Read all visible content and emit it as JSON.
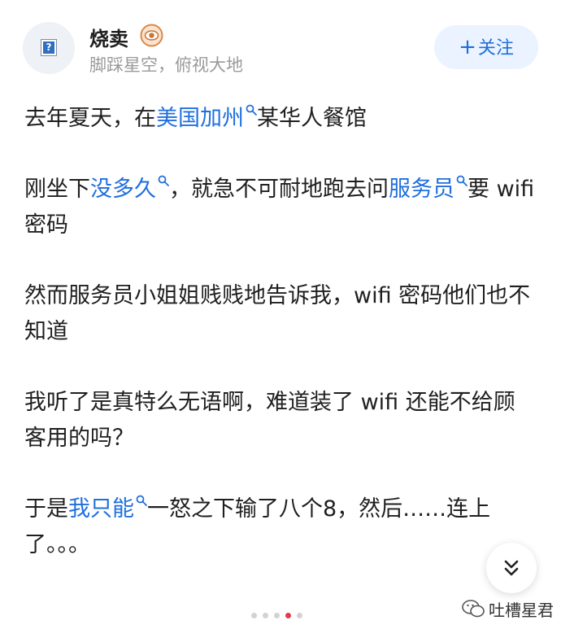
{
  "header": {
    "author_name": "烧卖",
    "author_bio": "脚踩星空，俯视大地",
    "follow_label": "关注"
  },
  "post": {
    "paragraphs": [
      [
        {
          "t": "去年夏天，在"
        },
        {
          "t": "美国加州",
          "link": true
        },
        {
          "t": "某华人餐馆"
        }
      ],
      [
        {
          "t": "刚坐下"
        },
        {
          "t": "没多久",
          "link": true
        },
        {
          "t": "，就急不可耐地跑去问"
        },
        {
          "t": "服务员",
          "link": true
        },
        {
          "t": "要 wifi 密码"
        }
      ],
      [
        {
          "t": "然而服务员小姐姐贱贱地告诉我，wifi 密码他们也不知道"
        }
      ],
      [
        {
          "t": "我听了是真特么无语啊，难道装了 wifi 还能不给顾客用的吗？"
        }
      ],
      [
        {
          "t": "于是"
        },
        {
          "t": "我只能",
          "link": true
        },
        {
          "t": "一怒之下输了八个8，然后……连上了。。。"
        }
      ]
    ]
  },
  "pager": {
    "count": 5,
    "active_index": 3
  },
  "watermark": {
    "text": "吐槽星君",
    "icon": "wechat-icon"
  },
  "icons": {
    "badge": "eye-badge-icon",
    "scroll": "double-chevron-down-icon",
    "keyword": "search-keyword-icon"
  },
  "colors": {
    "link": "#1f6fde",
    "follow_bg": "#eaf3ff",
    "active_dot": "#e33b4e"
  }
}
